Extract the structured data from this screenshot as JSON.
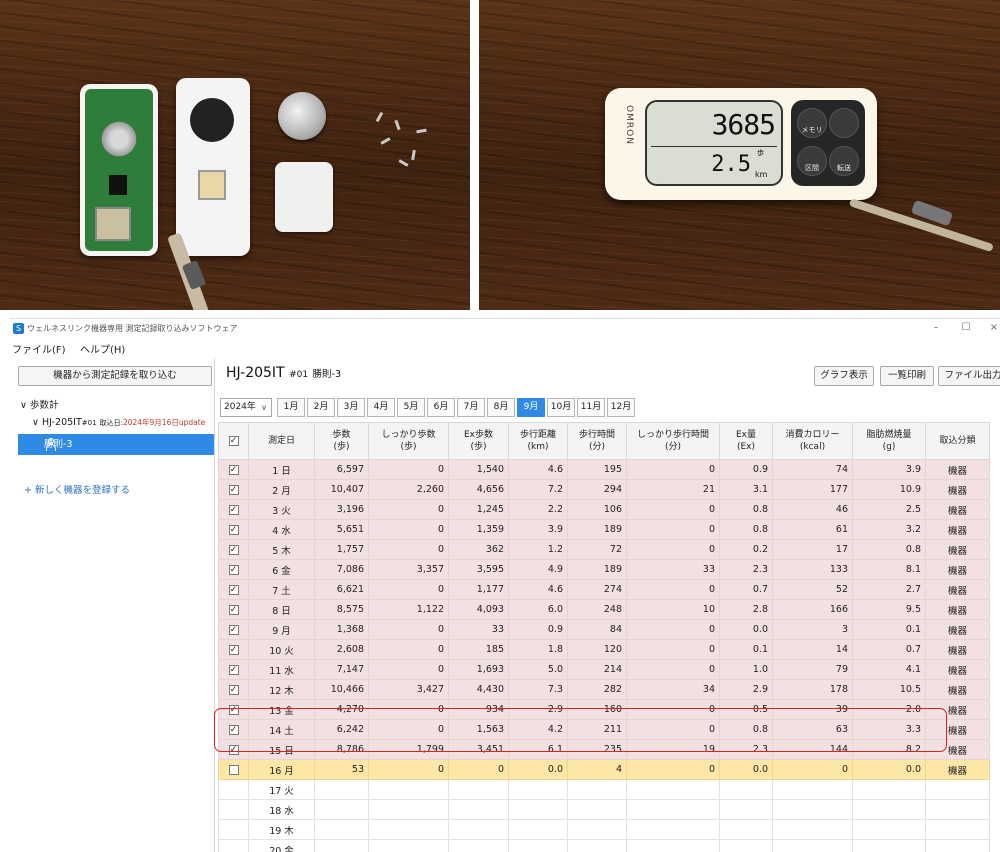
{
  "pedometer": {
    "brand": "OMRON",
    "steps": "3685",
    "steps_unit": "歩",
    "distance": "2.5",
    "distance_unit": "km",
    "buttons": [
      "メモリ 表示",
      "区間",
      " 転送"
    ]
  },
  "window": {
    "title": "ウェルネスリンク機器専用 測定記録取り込みソフトウェア",
    "controls": [
      "–",
      "☐",
      "×"
    ]
  },
  "menu": [
    "ファイル(F)",
    "ヘルプ(H)"
  ],
  "left_pane": {
    "import_button": "機器から測定記録を取り込む",
    "tree_root": "歩数計",
    "device_name": "HJ-205IT",
    "device_sub": "#01",
    "import_label": "取込日:",
    "import_date": "2024年9月16日update",
    "user": "勝則-3",
    "add_device": "新しく機器を登録する"
  },
  "header": {
    "device_name": "HJ-205IT",
    "device_sub": "#01",
    "user": "勝則-3",
    "buttons": [
      "グラフ表示",
      "一覧印刷",
      "ファイル出力"
    ]
  },
  "months": {
    "year": "2024年",
    "items": [
      "1月",
      "2月",
      "3月",
      "4月",
      "5月",
      "6月",
      "7月",
      "8月",
      "9月",
      "10月",
      "11月",
      "12月"
    ],
    "active": "9月"
  },
  "table": {
    "headers": [
      [
        "測定日"
      ],
      [
        "歩数",
        "(歩)"
      ],
      [
        "しっかり歩数",
        "(歩)"
      ],
      [
        "Ex歩数",
        "(歩)"
      ],
      [
        "歩行距離",
        "(km)"
      ],
      [
        "歩行時間",
        "(分)"
      ],
      [
        "しっかり歩行時間",
        "(分)"
      ],
      [
        "Ex量",
        "(Ex)"
      ],
      [
        "消費カロリー",
        "(kcal)"
      ],
      [
        "脂肪燃焼量",
        "(g)"
      ],
      [
        "取込分類"
      ]
    ],
    "rows": [
      {
        "day": "1 日",
        "k": "sun",
        "v": [
          "6,597",
          "0",
          "1,540",
          "4.6",
          "195",
          "0",
          "0.9",
          "74",
          "3.9",
          "機器"
        ],
        "cb": "✓",
        "st": "pink"
      },
      {
        "day": "2 月",
        "k": "",
        "v": [
          "10,407",
          "2,260",
          "4,656",
          "7.2",
          "294",
          "21",
          "3.1",
          "177",
          "10.9",
          "機器"
        ],
        "cb": "✓",
        "st": "pink"
      },
      {
        "day": "3 火",
        "k": "",
        "v": [
          "3,196",
          "0",
          "1,245",
          "2.2",
          "106",
          "0",
          "0.8",
          "46",
          "2.5",
          "機器"
        ],
        "cb": "✓",
        "st": "pink"
      },
      {
        "day": "4 水",
        "k": "",
        "v": [
          "5,651",
          "0",
          "1,359",
          "3.9",
          "189",
          "0",
          "0.8",
          "61",
          "3.2",
          "機器"
        ],
        "cb": "✓",
        "st": "pink"
      },
      {
        "day": "5 木",
        "k": "",
        "v": [
          "1,757",
          "0",
          "362",
          "1.2",
          "72",
          "0",
          "0.2",
          "17",
          "0.8",
          "機器"
        ],
        "cb": "✓",
        "st": "pink"
      },
      {
        "day": "6 金",
        "k": "",
        "v": [
          "7,086",
          "3,357",
          "3,595",
          "4.9",
          "189",
          "33",
          "2.3",
          "133",
          "8.1",
          "機器"
        ],
        "cb": "✓",
        "st": "pink"
      },
      {
        "day": "7 土",
        "k": "sat",
        "v": [
          "6,621",
          "0",
          "1,177",
          "4.6",
          "274",
          "0",
          "0.7",
          "52",
          "2.7",
          "機器"
        ],
        "cb": "✓",
        "st": "pink"
      },
      {
        "day": "8 日",
        "k": "sun",
        "v": [
          "8,575",
          "1,122",
          "4,093",
          "6.0",
          "248",
          "10",
          "2.8",
          "166",
          "9.5",
          "機器"
        ],
        "cb": "✓",
        "st": "pink"
      },
      {
        "day": "9 月",
        "k": "",
        "v": [
          "1,368",
          "0",
          "33",
          "0.9",
          "84",
          "0",
          "0.0",
          "3",
          "0.1",
          "機器"
        ],
        "cb": "✓",
        "st": "pink"
      },
      {
        "day": "10 火",
        "k": "",
        "v": [
          "2,608",
          "0",
          "185",
          "1.8",
          "120",
          "0",
          "0.1",
          "14",
          "0.7",
          "機器"
        ],
        "cb": "✓",
        "st": "pink"
      },
      {
        "day": "11 水",
        "k": "",
        "v": [
          "7,147",
          "0",
          "1,693",
          "5.0",
          "214",
          "0",
          "1.0",
          "79",
          "4.1",
          "機器"
        ],
        "cb": "✓",
        "st": "pink"
      },
      {
        "day": "12 木",
        "k": "",
        "v": [
          "10,466",
          "3,427",
          "4,430",
          "7.3",
          "282",
          "34",
          "2.9",
          "178",
          "10.5",
          "機器"
        ],
        "cb": "✓",
        "st": "pink"
      },
      {
        "day": "13 金",
        "k": "",
        "v": [
          "4,270",
          "0",
          "934",
          "2.9",
          "160",
          "0",
          "0.5",
          "39",
          "2.0",
          "機器"
        ],
        "cb": "✓",
        "st": "pink"
      },
      {
        "day": "14 土",
        "k": "sat",
        "v": [
          "6,242",
          "0",
          "1,563",
          "4.2",
          "211",
          "0",
          "0.8",
          "63",
          "3.3",
          "機器"
        ],
        "cb": "✓",
        "st": "pink"
      },
      {
        "day": "15 日",
        "k": "sun",
        "v": [
          "8,786",
          "1,799",
          "3,451",
          "6.1",
          "235",
          "19",
          "2.3",
          "144",
          "8.2",
          "機器"
        ],
        "cb": "✓",
        "st": "pink"
      },
      {
        "day": "16 月",
        "k": "",
        "v": [
          "53",
          "0",
          "0",
          "0.0",
          "4",
          "0",
          "0.0",
          "0",
          "0.0",
          "機器"
        ],
        "cb": "",
        "st": "yellow"
      },
      {
        "day": "17 火",
        "k": "",
        "v": [
          "",
          "",
          "",
          "",
          "",
          "",
          "",
          "",
          "",
          ""
        ],
        "cb": null,
        "st": "empty"
      },
      {
        "day": "18 水",
        "k": "",
        "v": [
          "",
          "",
          "",
          "",
          "",
          "",
          "",
          "",
          "",
          ""
        ],
        "cb": null,
        "st": "empty"
      },
      {
        "day": "19 木",
        "k": "",
        "v": [
          "",
          "",
          "",
          "",
          "",
          "",
          "",
          "",
          "",
          ""
        ],
        "cb": null,
        "st": "empty"
      },
      {
        "day": "20 金",
        "k": "",
        "v": [
          "",
          "",
          "",
          "",
          "",
          "",
          "",
          "",
          "",
          ""
        ],
        "cb": null,
        "st": "empty"
      }
    ]
  },
  "colors": {
    "accent": "#2f8ae6",
    "pink_row": "#f3e0e0",
    "yellow_row": "#fde7a6",
    "sunday": "#c62828",
    "saturday": "#1e6fd0",
    "highlight": "#dd2222"
  }
}
